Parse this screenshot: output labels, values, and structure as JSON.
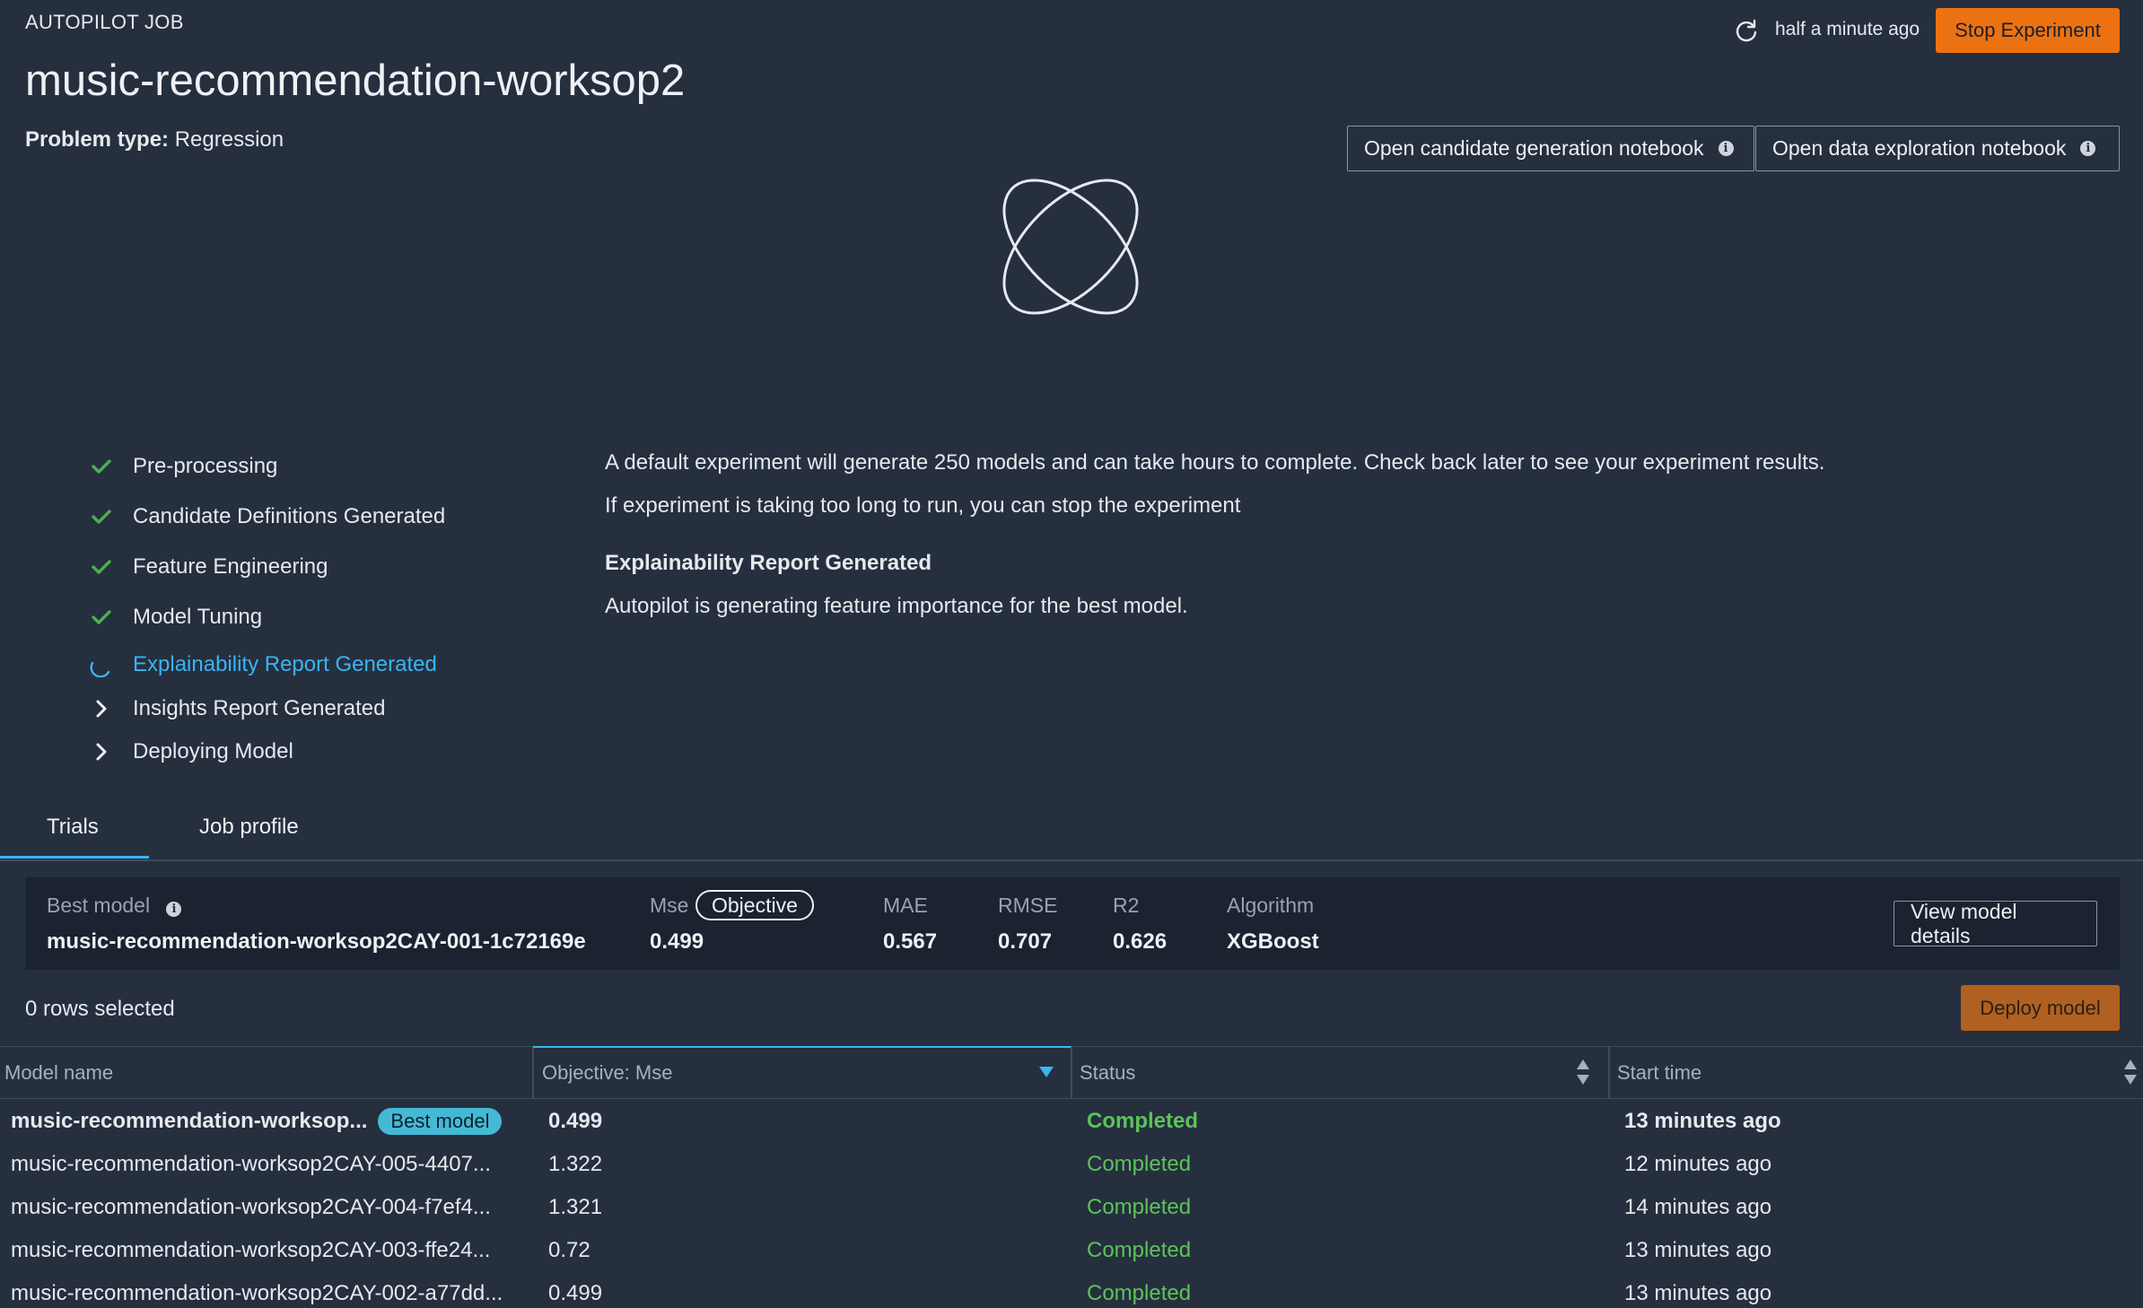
{
  "header": {
    "eyebrow": "AUTOPILOT JOB",
    "title": "music-recommendation-worksop2",
    "problem_type_label": "Problem type:",
    "problem_type_value": "Regression",
    "updated": "half a minute ago",
    "stop_label": "Stop Experiment",
    "candidate_notebook_label": "Open candidate generation notebook",
    "exploration_notebook_label": "Open data exploration notebook"
  },
  "steps": [
    {
      "label": "Pre-processing",
      "state": "done"
    },
    {
      "label": "Candidate Definitions Generated",
      "state": "done"
    },
    {
      "label": "Feature Engineering",
      "state": "done"
    },
    {
      "label": "Model Tuning",
      "state": "done"
    },
    {
      "label": "Explainability Report Generated",
      "state": "active"
    },
    {
      "label": "Insights Report Generated",
      "state": "pending"
    },
    {
      "label": "Deploying Model",
      "state": "pending"
    }
  ],
  "messages": {
    "line1": "A default experiment will generate 250 models and can take hours to complete. Check back later to see your experiment results.",
    "line2": "If experiment is taking too long to run, you can stop the experiment",
    "heading": "Explainability Report Generated",
    "line3": "Autopilot is generating feature importance for the best model."
  },
  "tabs": [
    {
      "label": "Trials",
      "selected": true
    },
    {
      "label": "Job profile",
      "selected": false
    }
  ],
  "best_model": {
    "label": "Best model",
    "name": "music-recommendation-worksop2CAY-001-1c72169e",
    "mse_label": "Mse",
    "objective_label": "Objective",
    "mse": "0.499",
    "mae_label": "MAE",
    "mae": "0.567",
    "rmse_label": "RMSE",
    "rmse": "0.707",
    "r2_label": "R2",
    "r2": "0.626",
    "algorithm_label": "Algorithm",
    "algorithm": "XGBoost",
    "view_label": "View model details"
  },
  "selection": {
    "rows_selected": "0 rows selected",
    "deploy_label": "Deploy model"
  },
  "table": {
    "columns": [
      "Model name",
      "Objective: Mse",
      "Status",
      "Start time"
    ],
    "best_badge": "Best model",
    "rows": [
      {
        "name": "music-recommendation-worksop...",
        "objective": "0.499",
        "status": "Completed",
        "start": "13 minutes ago"
      },
      {
        "name": "music-recommendation-worksop2CAY-005-4407...",
        "objective": "1.322",
        "status": "Completed",
        "start": "12 minutes ago"
      },
      {
        "name": "music-recommendation-worksop2CAY-004-f7ef4...",
        "objective": "1.321",
        "status": "Completed",
        "start": "14 minutes ago"
      },
      {
        "name": "music-recommendation-worksop2CAY-003-ffe24...",
        "objective": "0.72",
        "status": "Completed",
        "start": "13 minutes ago"
      },
      {
        "name": "music-recommendation-worksop2CAY-002-a77dd...",
        "objective": "0.499",
        "status": "Completed",
        "start": "13 minutes ago"
      }
    ]
  },
  "colors": {
    "background": "#262f3e",
    "accent": "#3ab4f2",
    "stop_button": "#ec7211",
    "success": "#5cc35a",
    "best_badge": "#44b9d6"
  },
  "icons": [
    "refresh-icon",
    "info-icon",
    "autopilot-orbit-icon",
    "check-icon",
    "spinner-icon",
    "chevron-right-icon",
    "sort-desc-icon",
    "sort-icon"
  ]
}
